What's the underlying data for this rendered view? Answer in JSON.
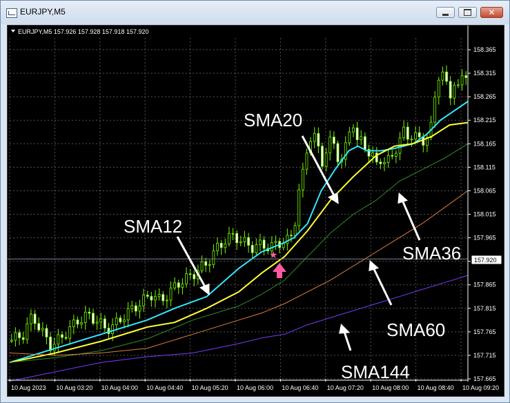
{
  "window": {
    "title": "EURJPY,M5",
    "min_icon": "minimize-icon",
    "max_icon": "maximize-icon",
    "close_icon": "close-icon"
  },
  "chart_header": {
    "symbol_line": "EURJPY,M5  157.926 157.928 157.918 157.920"
  },
  "colors": {
    "background": "#000000",
    "grid": "#9a9a9a",
    "candle": "#7cfc00",
    "sma12": "#33e8ff",
    "sma20": "#ffff33",
    "sma36": "#2f8f2f",
    "sma60": "#e0803a",
    "sma144": "#7a3cff",
    "price_line": "#7a8a9a",
    "marker": "#ff5aa0"
  },
  "current_price_label": "157.920",
  "annotations": [
    {
      "text": "SMA20"
    },
    {
      "text": "SMA12"
    },
    {
      "text": "SMA36"
    },
    {
      "text": "SMA60"
    },
    {
      "text": "SMA144"
    }
  ],
  "marker": {
    "star_icon": "star-icon",
    "arrow_icon": "up-arrow-icon"
  },
  "chart_data": {
    "type": "candlestick",
    "symbol": "EURJPY",
    "timeframe": "M5",
    "ylim": [
      157.665,
      158.39
    ],
    "y_ticks": [
      "158.365",
      "158.315",
      "158.265",
      "158.215",
      "158.165",
      "158.115",
      "158.065",
      "158.015",
      "157.965",
      "157.915",
      "157.865",
      "157.815",
      "157.765",
      "157.715",
      "157.665"
    ],
    "x_ticks": [
      "10 Aug 2023",
      "10 Aug 03:20",
      "10 Aug 04:00",
      "10 Aug 04:40",
      "10 Aug 05:20",
      "10 Aug 06:00",
      "10 Aug 06:40",
      "10 Aug 07:20",
      "10 Aug 08:00",
      "10 Aug 08:40",
      "10 Aug 09:20"
    ],
    "x_range": [
      0,
      100
    ],
    "close_anchors": [
      [
        0,
        157.745
      ],
      [
        3,
        157.76
      ],
      [
        5,
        157.8
      ],
      [
        7,
        157.765
      ],
      [
        9,
        157.735
      ],
      [
        11,
        157.75
      ],
      [
        13,
        157.77
      ],
      [
        15,
        157.79
      ],
      [
        17,
        157.8
      ],
      [
        19,
        157.79
      ],
      [
        21,
        157.77
      ],
      [
        23,
        157.78
      ],
      [
        25,
        157.8
      ],
      [
        27,
        157.815
      ],
      [
        29,
        157.83
      ],
      [
        31,
        157.845
      ],
      [
        33,
        157.83
      ],
      [
        35,
        157.85
      ],
      [
        37,
        157.87
      ],
      [
        39,
        157.88
      ],
      [
        41,
        157.895
      ],
      [
        43,
        157.91
      ],
      [
        45,
        157.94
      ],
      [
        47,
        157.96
      ],
      [
        49,
        157.97
      ],
      [
        51,
        157.955
      ],
      [
        53,
        157.945
      ],
      [
        55,
        157.95
      ],
      [
        57,
        157.945
      ],
      [
        59,
        157.955
      ],
      [
        61,
        157.96
      ],
      [
        62,
        157.98
      ],
      [
        63,
        158.06
      ],
      [
        64,
        158.1
      ],
      [
        65,
        158.16
      ],
      [
        66,
        158.19
      ],
      [
        67,
        158.17
      ],
      [
        68,
        158.12
      ],
      [
        69,
        158.15
      ],
      [
        70,
        158.17
      ],
      [
        71,
        158.16
      ],
      [
        72,
        158.125
      ],
      [
        73,
        158.14
      ],
      [
        74,
        158.19
      ],
      [
        75,
        158.21
      ],
      [
        76,
        158.16
      ],
      [
        77,
        158.175
      ],
      [
        78,
        158.15
      ],
      [
        79,
        158.14
      ],
      [
        80,
        158.12
      ],
      [
        81,
        158.135
      ],
      [
        82,
        158.125
      ],
      [
        83,
        158.13
      ],
      [
        84,
        158.15
      ],
      [
        85,
        158.17
      ],
      [
        86,
        158.19
      ],
      [
        87,
        158.18
      ],
      [
        88,
        158.185
      ],
      [
        89,
        158.175
      ],
      [
        90,
        158.17
      ],
      [
        91,
        158.18
      ],
      [
        92,
        158.2
      ],
      [
        93,
        158.28
      ],
      [
        94,
        158.33
      ],
      [
        95,
        158.3
      ],
      [
        96,
        158.26
      ],
      [
        97,
        158.3
      ],
      [
        98,
        158.28
      ],
      [
        99,
        158.31
      ],
      [
        100,
        158.32
      ]
    ],
    "series": [
      {
        "name": "SMA12",
        "points": [
          [
            0,
            157.7
          ],
          [
            10,
            157.73
          ],
          [
            20,
            157.76
          ],
          [
            30,
            157.79
          ],
          [
            36,
            157.815
          ],
          [
            43,
            157.84
          ],
          [
            50,
            157.9
          ],
          [
            55,
            157.935
          ],
          [
            60,
            157.955
          ],
          [
            62,
            157.965
          ],
          [
            65,
            157.995
          ],
          [
            68,
            158.065
          ],
          [
            71,
            158.11
          ],
          [
            74,
            158.15
          ],
          [
            76,
            158.16
          ],
          [
            78,
            158.15
          ],
          [
            81,
            158.15
          ],
          [
            84,
            158.155
          ],
          [
            88,
            158.165
          ],
          [
            91,
            158.185
          ],
          [
            94,
            158.215
          ],
          [
            97,
            158.235
          ],
          [
            100,
            158.255
          ]
        ]
      },
      {
        "name": "SMA20",
        "points": [
          [
            0,
            157.7
          ],
          [
            10,
            157.72
          ],
          [
            20,
            157.745
          ],
          [
            30,
            157.775
          ],
          [
            36,
            157.785
          ],
          [
            43,
            157.815
          ],
          [
            50,
            157.85
          ],
          [
            55,
            157.89
          ],
          [
            60,
            157.925
          ],
          [
            65,
            157.98
          ],
          [
            70,
            158.045
          ],
          [
            75,
            158.095
          ],
          [
            80,
            158.14
          ],
          [
            84,
            158.16
          ],
          [
            88,
            158.165
          ],
          [
            92,
            158.18
          ],
          [
            96,
            158.205
          ],
          [
            100,
            158.21
          ]
        ]
      },
      {
        "name": "SMA36",
        "points": [
          [
            0,
            157.7
          ],
          [
            10,
            157.71
          ],
          [
            20,
            157.725
          ],
          [
            30,
            157.75
          ],
          [
            40,
            157.79
          ],
          [
            50,
            157.82
          ],
          [
            55,
            157.845
          ],
          [
            60,
            157.875
          ],
          [
            65,
            157.925
          ],
          [
            70,
            157.975
          ],
          [
            75,
            158.015
          ],
          [
            80,
            158.045
          ],
          [
            85,
            158.085
          ],
          [
            90,
            158.11
          ],
          [
            95,
            158.135
          ],
          [
            100,
            158.165
          ]
        ]
      },
      {
        "name": "SMA60",
        "points": [
          [
            0,
            157.72
          ],
          [
            10,
            157.715
          ],
          [
            20,
            157.72
          ],
          [
            30,
            157.73
          ],
          [
            40,
            157.76
          ],
          [
            50,
            157.79
          ],
          [
            55,
            157.805
          ],
          [
            60,
            157.825
          ],
          [
            65,
            157.85
          ],
          [
            70,
            157.875
          ],
          [
            75,
            157.905
          ],
          [
            80,
            157.935
          ],
          [
            85,
            157.965
          ],
          [
            90,
            157.995
          ],
          [
            95,
            158.03
          ],
          [
            100,
            158.065
          ]
        ]
      },
      {
        "name": "SMA144",
        "points": [
          [
            0,
            157.66
          ],
          [
            10,
            157.68
          ],
          [
            20,
            157.7
          ],
          [
            30,
            157.712
          ],
          [
            40,
            157.72
          ],
          [
            50,
            157.74
          ],
          [
            55,
            157.752
          ],
          [
            60,
            157.76
          ],
          [
            65,
            157.78
          ],
          [
            70,
            157.795
          ],
          [
            75,
            157.81
          ],
          [
            80,
            157.825
          ],
          [
            85,
            157.84
          ],
          [
            90,
            157.855
          ],
          [
            95,
            157.87
          ],
          [
            100,
            157.885
          ]
        ]
      }
    ],
    "current_price": 157.92
  }
}
